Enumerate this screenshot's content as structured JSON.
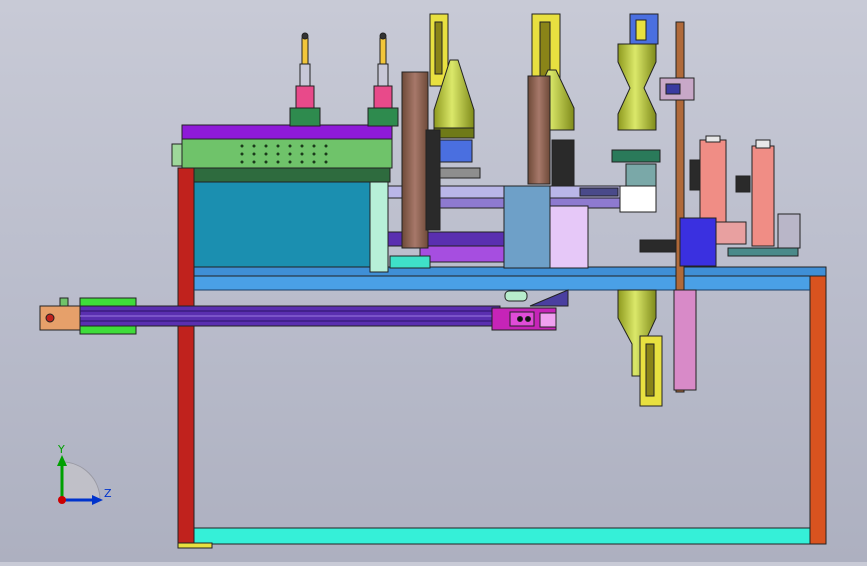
{
  "axes": {
    "y_label": "Y",
    "z_label": "Z",
    "y_color": "#00a000",
    "z_color": "#0033cc",
    "origin_color": "#cc0000"
  },
  "palette": {
    "frame_red": "#c0221d",
    "frame_orange": "#d9531f",
    "table_blue": "#3f8fd6",
    "cyan_rail": "#35f0d8",
    "purple": "#8e1ad8",
    "green_plate": "#6fc36a",
    "teal_box": "#1b8fb0",
    "olive_horn": "#b9c83a",
    "brown_post": "#9a6a52",
    "pink_column": "#f08d85",
    "magenta": "#c624b8",
    "yellow": "#e8e040"
  }
}
